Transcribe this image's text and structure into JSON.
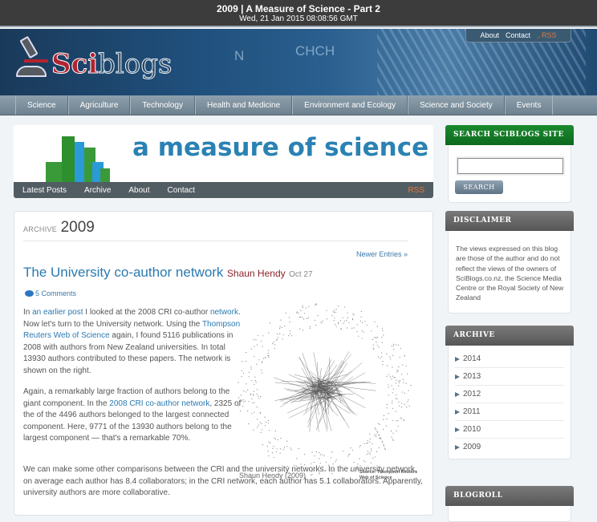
{
  "window": {
    "title": "2009 | A Measure of Science - Part 2",
    "timestamp": "Wed, 21 Jan 2015 08:08:56 GMT"
  },
  "site": {
    "logo_sci": "Sci",
    "logo_blogs": "blogs",
    "header_chem_1": "CHCH",
    "header_chem_2": "N",
    "toplinks": [
      {
        "label": "About"
      },
      {
        "label": "Contact"
      },
      {
        "label": "RSS",
        "icon": "rss-icon"
      }
    ],
    "nav": [
      {
        "label": "Science"
      },
      {
        "label": "Agriculture"
      },
      {
        "label": "Technology"
      },
      {
        "label": "Health and Medicine"
      },
      {
        "label": "Environment and Ecology"
      },
      {
        "label": "Science and Society"
      },
      {
        "label": "Events"
      }
    ]
  },
  "blog": {
    "banner_title": "a measure of science",
    "nav": [
      {
        "label": "Latest Posts"
      },
      {
        "label": "Archive"
      },
      {
        "label": "About"
      },
      {
        "label": "Contact"
      }
    ],
    "rss_label": "RSS",
    "colors": {
      "green": "#3a9a3a",
      "blue": "#2a9ad8",
      "title": "#2a82b3"
    }
  },
  "archive": {
    "label": "ARCHIVE",
    "year": "2009",
    "newer_entries": "Newer Entries »"
  },
  "post": {
    "title": "The University co-author network",
    "author": "Shaun Hendy",
    "date": "Oct 27",
    "comments": "5 Comments",
    "p1": {
      "t1": "In ",
      "link1": "an earlier post",
      "t2": " I looked at the 2008 CRI co-author ",
      "link2": "network",
      "t3": ". Now let's turn to the University network. Using the ",
      "link3": "Thompson Reuters Web of Science",
      "t4": " again, I found 5116 publications in 2008 with authors from New Zealand universities. In total 13930 authors contributed to these papers. The network is shown on the right."
    },
    "p2": {
      "t1": "Again, a remarkably large fraction of authors belong to the giant component. In the ",
      "link1": "2008 CRI co-author network",
      "t2": ", 2325 of the of the 4496 authors belonged to the largest connected component. Here, 9771 of the 13930 authors belong to the largest component — that's a remarkable 70%."
    },
    "p3": "We can make some other comparisons between the CRI and the university networks. In the university network, on average each author has 8.4 collaborators; in the CRI network, each author has 5.1 collaborators. Apparently, university authors are more collaborative.",
    "figure": {
      "caption": "Shaun Hendy (2009)",
      "source_line1": "Source: Thompson Reuters",
      "source_line2": "Web of Science"
    }
  },
  "sidebar": {
    "search": {
      "title": "SEARCH SCIBLOGS SITE",
      "value": "",
      "button": "SEARCH"
    },
    "disclaimer": {
      "title": "DISCLAIMER",
      "text": "The views expressed on this blog are those of the author and do not reflect the views of the owners of SciBlogs.co.nz, the Science Media Centre or the Royal Society of New Zealand"
    },
    "archive": {
      "title": "ARCHIVE",
      "years": [
        {
          "label": "2014"
        },
        {
          "label": "2013"
        },
        {
          "label": "2012"
        },
        {
          "label": "2011"
        },
        {
          "label": "2010"
        },
        {
          "label": "2009"
        }
      ]
    },
    "blogroll": {
      "title": "BLOGROLL"
    }
  }
}
